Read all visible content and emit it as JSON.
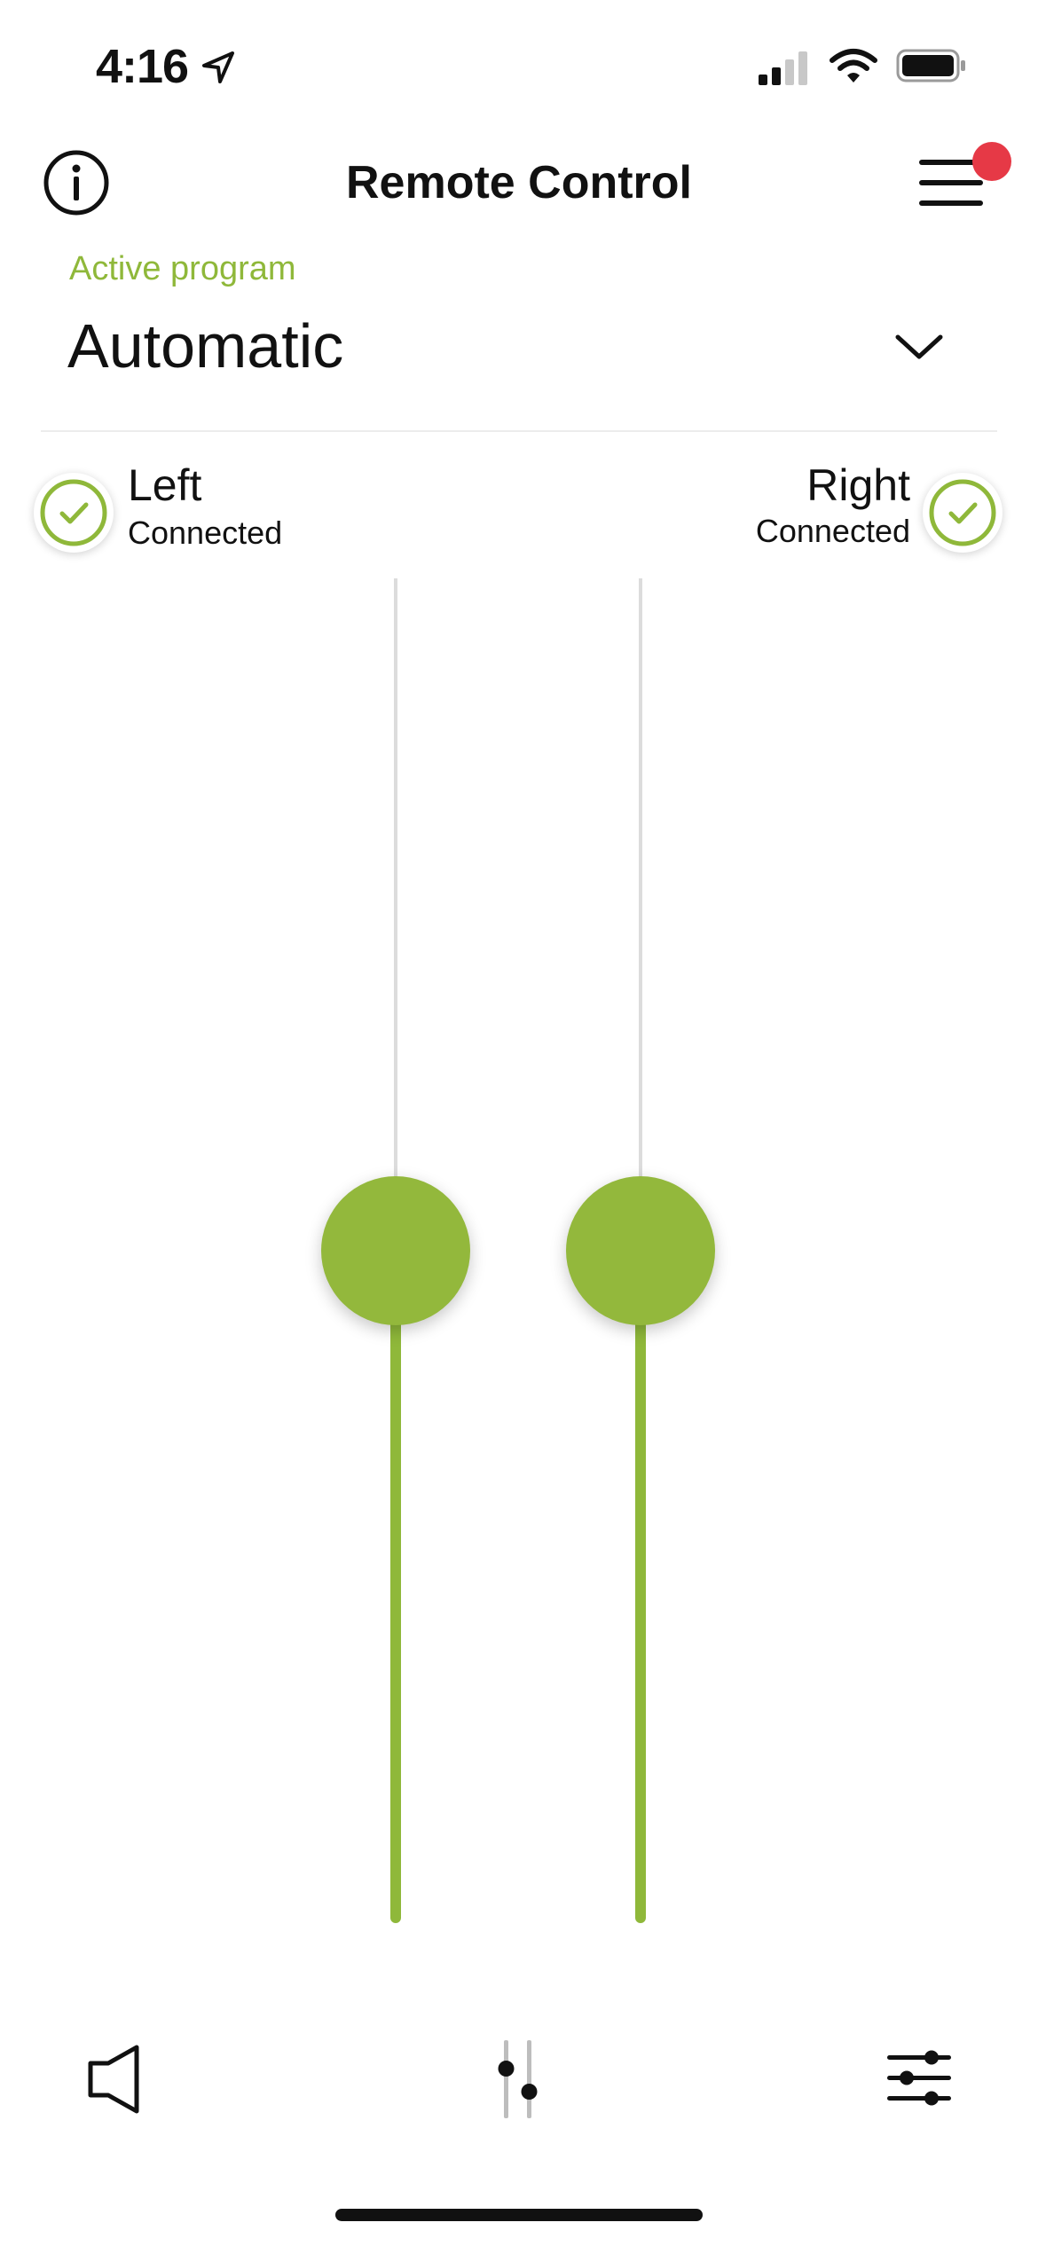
{
  "status_bar": {
    "time": "4:16",
    "icons": [
      "location-arrow-icon",
      "signal-icon",
      "wifi-icon",
      "battery-icon"
    ]
  },
  "header": {
    "title": "Remote Control",
    "left_icon": "info-icon",
    "right_icon": "menu-icon",
    "notification_dot": true
  },
  "program": {
    "label": "Active program",
    "value": "Automatic"
  },
  "devices": {
    "left": {
      "name": "Left",
      "status": "Connected"
    },
    "right": {
      "name": "Right",
      "status": "Connected"
    }
  },
  "sliders": {
    "left_level": 0.5,
    "right_level": 0.5
  },
  "bottom_nav": {
    "tabs": [
      "sound-icon",
      "volume-sliders-icon",
      "settings-sliders-icon"
    ]
  },
  "colors": {
    "accent": "#8fb83a",
    "notification": "#e63946",
    "text": "#111111",
    "track": "#dcdcdc"
  }
}
